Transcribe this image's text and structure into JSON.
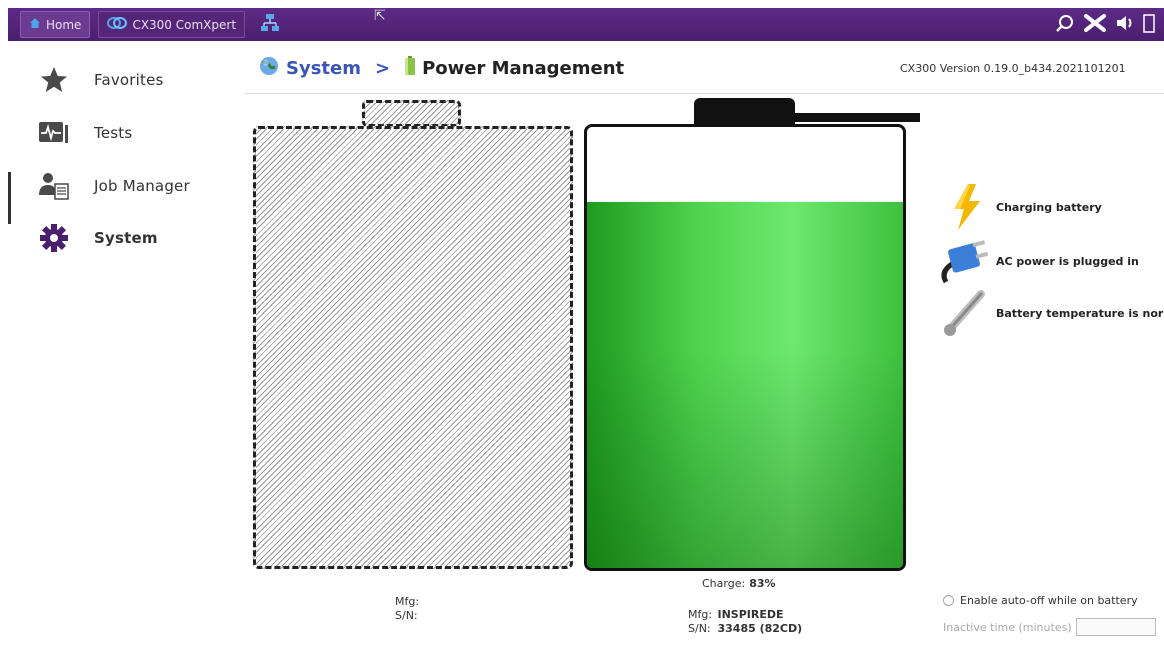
{
  "topbar": {
    "home_label": "Home",
    "app_label": "CX300 ComXpert",
    "cursor": "⇱"
  },
  "sidebar": {
    "items": [
      {
        "label": "Favorites",
        "icon": "star-icon"
      },
      {
        "label": "Tests",
        "icon": "tests-icon"
      },
      {
        "label": "Job Manager",
        "icon": "job-manager-icon"
      },
      {
        "label": "System",
        "icon": "gear-icon"
      }
    ],
    "active": "System"
  },
  "header": {
    "breadcrumb_root": "System",
    "separator": ">",
    "breadcrumb_current": "Power Management",
    "version": "CX300 Version 0.19.0_b434.2021101201"
  },
  "battery_empty": {
    "mfg_label": "Mfg:",
    "mfg_value": "",
    "sn_label": "S/N:",
    "sn_value": ""
  },
  "battery_full": {
    "charge_label": "Charge:",
    "charge_value": "83%",
    "charge_fraction": 0.83,
    "mfg_label": "Mfg:",
    "mfg_value": "INSPIREDE",
    "sn_label": "S/N:",
    "sn_value": "33485 (82CD)"
  },
  "status": [
    {
      "text": "Charging battery",
      "icon": "lightning-icon",
      "color": "#f5b800"
    },
    {
      "text": "AC power is plugged in",
      "icon": "plug-icon",
      "color": "#3b7fd9"
    },
    {
      "text": "Battery temperature is normal",
      "icon": "thermometer-icon",
      "color": "#999999"
    }
  ],
  "auto_off": {
    "label": "Enable auto-off while on battery",
    "inactive_label": "Inactive time (minutes)",
    "inactive_value": ""
  },
  "colors": {
    "topbar": "#4a1f6e",
    "link": "#3a55b8",
    "battery_green": "#4fd34f"
  }
}
